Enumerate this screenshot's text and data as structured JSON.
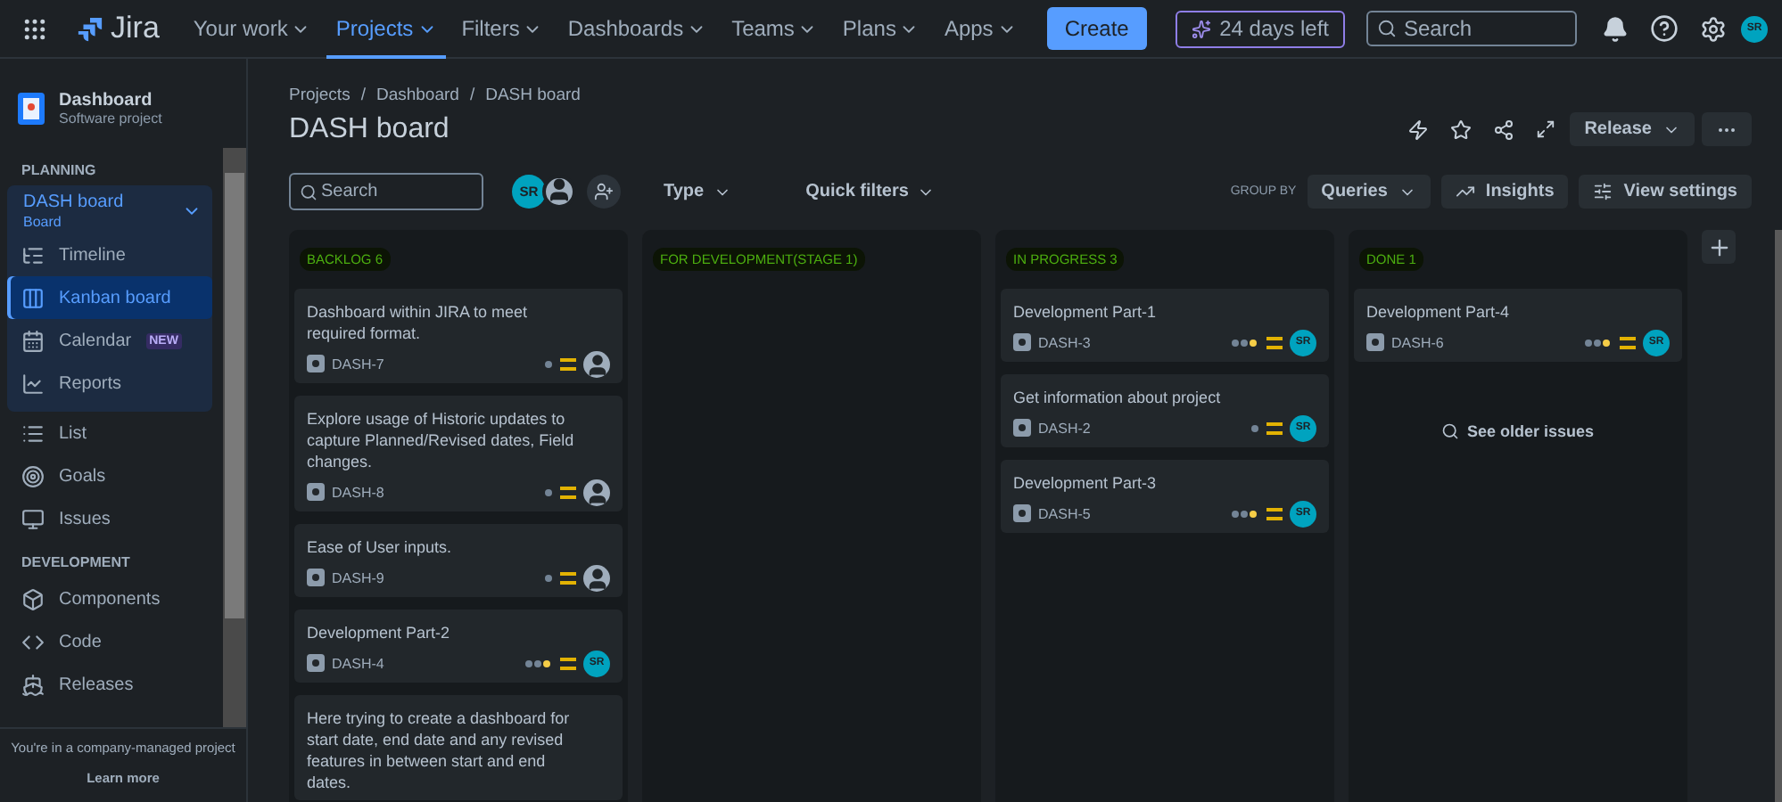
{
  "topbar": {
    "product": "Jira",
    "nav": [
      {
        "label": "Your work",
        "selected": false
      },
      {
        "label": "Projects",
        "selected": true
      },
      {
        "label": "Filters",
        "selected": false
      },
      {
        "label": "Dashboards",
        "selected": false
      },
      {
        "label": "Teams",
        "selected": false
      },
      {
        "label": "Plans",
        "selected": false
      },
      {
        "label": "Apps",
        "selected": false
      }
    ],
    "create": "Create",
    "trial": "24 days left",
    "search": {
      "placeholder": "Search"
    },
    "avatar": "SR"
  },
  "sidebar": {
    "project": {
      "name": "Dashboard",
      "type": "Software project"
    },
    "sections": [
      {
        "title": "PLANNING",
        "group": {
          "label": "DASH board",
          "sublabel": "Board",
          "expanded": true,
          "items": [
            {
              "label": "Timeline",
              "kind": "timeline",
              "selected": false
            },
            {
              "label": "Kanban board",
              "kind": "board",
              "selected": true
            },
            {
              "label": "Calendar",
              "kind": "calendar",
              "badge": "NEW",
              "selected": false
            },
            {
              "label": "Reports",
              "kind": "reports",
              "selected": false
            }
          ]
        },
        "items": [
          {
            "label": "List",
            "kind": "list",
            "selected": false
          },
          {
            "label": "Goals",
            "kind": "goals",
            "selected": false
          },
          {
            "label": "Issues",
            "kind": "issues",
            "selected": false
          }
        ]
      },
      {
        "title": "DEVELOPMENT",
        "items": [
          {
            "label": "Components",
            "kind": "components",
            "selected": false
          },
          {
            "label": "Code",
            "kind": "code",
            "selected": false
          },
          {
            "label": "Releases",
            "kind": "releases",
            "selected": false
          }
        ]
      }
    ],
    "footer": {
      "text": "You're in a company-managed project",
      "link": "Learn more"
    }
  },
  "breadcrumbs": [
    {
      "label": "Projects"
    },
    {
      "separator": "/",
      "label": "Dashboard"
    },
    {
      "separator": "/",
      "label": "DASH board"
    }
  ],
  "title": "DASH board",
  "header_actions": {
    "release": "Release"
  },
  "toolbar": {
    "search": {
      "placeholder": "Search"
    },
    "avatar": "SR",
    "type": "Type",
    "quick_filters": "Quick filters",
    "group_by_label": "GROUP BY",
    "group_by": "Queries",
    "insights": "Insights",
    "view_settings": "View settings"
  },
  "columns": [
    {
      "title": "BACKLOG 6",
      "cards": [
        {
          "summary": "Dashboard within JIRA to meet required format.",
          "key": "DASH-7",
          "in_progress": false
        },
        {
          "summary": "Explore usage of Historic updates to capture Planned/Revised dates, Field changes.",
          "key": "DASH-8",
          "in_progress": false
        },
        {
          "summary": "Ease of User inputs.",
          "key": "DASH-9",
          "in_progress": false
        },
        {
          "summary": "Development Part-2",
          "key": "DASH-4",
          "in_progress": true,
          "assignee": "SR"
        },
        {
          "summary": "Here trying to create a dashboard for start date, end date and any revised features in between start and end dates."
        }
      ]
    },
    {
      "title": "FOR DEVELOPMENT(STAGE 1)"
    },
    {
      "title": "IN PROGRESS 3",
      "cards": [
        {
          "summary": "Development Part-1",
          "key": "DASH-3",
          "in_progress": true,
          "assignee": "SR"
        },
        {
          "summary": "Get information about project",
          "key": "DASH-2",
          "in_progress": false,
          "assignee": "SR"
        },
        {
          "summary": "Development Part-3",
          "key": "DASH-5",
          "in_progress": true,
          "assignee": "SR"
        }
      ]
    },
    {
      "title": "DONE 1",
      "cards": [
        {
          "summary": "Development Part-4",
          "key": "DASH-6",
          "in_progress": true,
          "assignee": "SR"
        }
      ],
      "footer": "See older issues"
    }
  ]
}
